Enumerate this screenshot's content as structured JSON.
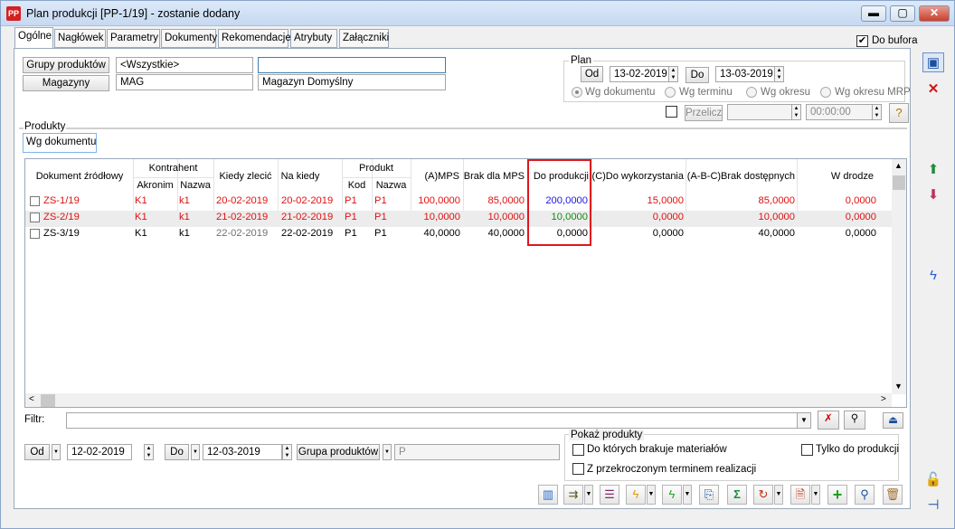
{
  "window": {
    "title": "Plan produkcji [PP-1/19] - zostanie dodany",
    "app_icon": "PP",
    "buttons": {
      "minimize": "▬",
      "maximize": "▢",
      "close": "✕"
    }
  },
  "tabs": [
    {
      "label": "Ogólne"
    },
    {
      "label": "Nagłówek"
    },
    {
      "label": "Parametry"
    },
    {
      "label": "Dokumenty"
    },
    {
      "label": "Rekomendacje"
    },
    {
      "label": "Atrybuty"
    },
    {
      "label": "Załączniki"
    }
  ],
  "do_bufora": {
    "label": "Do bufora",
    "checked": true
  },
  "filters": {
    "grupy_btn": "Grupy produktów",
    "grupy_value": "<Wszystkie>",
    "grupy_extra": "",
    "magazyny_btn": "Magazyny",
    "magazyn_code": "MAG",
    "magazyn_name": "Magazyn Domyślny"
  },
  "plan": {
    "group_label": "Plan",
    "od_label": "Od",
    "od_value": "13-02-2019",
    "do_label": "Do",
    "do_value": "13-03-2019",
    "radios": [
      {
        "label": "Wg dokumentu",
        "selected": true
      },
      {
        "label": "Wg terminu",
        "selected": false
      },
      {
        "label": "Wg okresu",
        "selected": false
      },
      {
        "label": "Wg okresu MRP",
        "selected": false
      }
    ],
    "przelicz_label": "Przelicz",
    "przelicz_value": "",
    "time_value": "00:00:00"
  },
  "produkty": {
    "group_label": "Produkty",
    "subtab": "Wg dokumentu"
  },
  "table": {
    "headers": {
      "dok": "Dokument źródłowy",
      "kontrahent": "Kontrahent",
      "akronim": "Akronim",
      "nazwa": "Nazwa",
      "kiedy_zlecic": "Kiedy zlecić",
      "na_kiedy": "Na kiedy",
      "produkt": "Produkt",
      "kod": "Kod",
      "pnazwa": "Nazwa",
      "mps": "(A)MPS",
      "brak_mps": "Brak dla MPS",
      "do_produkcji": "Do produkcji",
      "do_wyk": "(C)Do wykorzystania",
      "brak_dost": "(A-B-C)Brak dostępnych",
      "w_drodze": "W drodze"
    },
    "rows": [
      {
        "dok": "ZS-1/19",
        "akronim": "K1",
        "nazwa": "k1",
        "kiedy": "20-02-2019",
        "na_kiedy": "20-02-2019",
        "kod": "P1",
        "pnazwa": "P1",
        "mps": "100,0000",
        "brak_mps": "85,0000",
        "do_prod": "200,0000",
        "do_wyk": "15,0000",
        "brak_dost": "85,0000",
        "w_drodze": "0,0000"
      },
      {
        "dok": "ZS-2/19",
        "akronim": "K1",
        "nazwa": "k1",
        "kiedy": "21-02-2019",
        "na_kiedy": "21-02-2019",
        "kod": "P1",
        "pnazwa": "P1",
        "mps": "10,0000",
        "brak_mps": "10,0000",
        "do_prod": "10,0000",
        "do_wyk": "0,0000",
        "brak_dost": "10,0000",
        "w_drodze": "0,0000"
      },
      {
        "dok": "ZS-3/19",
        "akronim": "K1",
        "nazwa": "k1",
        "kiedy": "22-02-2019",
        "na_kiedy": "22-02-2019",
        "kod": "P1",
        "pnazwa": "P1",
        "mps": "40,0000",
        "brak_mps": "40,0000",
        "do_prod": "0,0000",
        "do_wyk": "0,0000",
        "brak_dost": "40,0000",
        "w_drodze": "0,0000"
      }
    ]
  },
  "filtr": {
    "label": "Filtr:",
    "value": ""
  },
  "bottom": {
    "od_label": "Od",
    "od_value": "12-02-2019",
    "do_label": "Do",
    "do_value": "12-03-2019",
    "grupa_btn": "Grupa produktów",
    "grupa_value": "P"
  },
  "pokaz": {
    "group_label": "Pokaż produkty",
    "opt1": "Do których brakuje materiałów",
    "opt2": "Z przekroczonym terminem realizacji",
    "opt3": "Tylko do produkcji"
  },
  "colors": {
    "red": "#e01010",
    "blue": "#1a1adf",
    "green": "#108a10",
    "highlight": "#e0151e"
  }
}
